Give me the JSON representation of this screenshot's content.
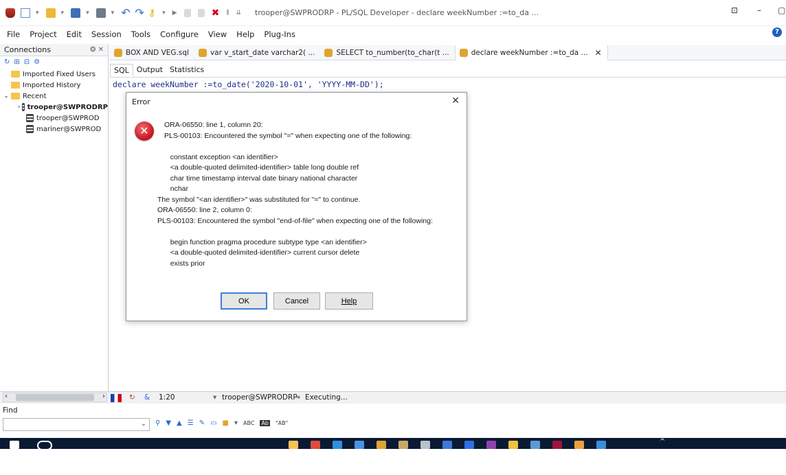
{
  "window": {
    "title": "trooper@SWPRODRP - PL/SQL Developer - declare weekNumber :=to_da ..."
  },
  "menu": [
    "File",
    "Project",
    "Edit",
    "Session",
    "Tools",
    "Configure",
    "View",
    "Help",
    "Plug-Ins"
  ],
  "left_panel": {
    "title": "Connections",
    "pin": "❂ ✕",
    "tree": [
      {
        "label": "Imported Fixed Users",
        "type": "folder"
      },
      {
        "label": "Imported History",
        "type": "folder"
      },
      {
        "label": "Recent",
        "type": "folder",
        "expanded": true
      },
      {
        "label": "trooper@SWPRODRP",
        "type": "db",
        "bold": true
      },
      {
        "label": "trooper@SWPROD",
        "type": "db"
      },
      {
        "label": "mariner@SWPROD",
        "type": "db"
      }
    ]
  },
  "tabs": [
    {
      "label": "BOX AND VEG.sql"
    },
    {
      "label": "var v_start_date varchar2( ..."
    },
    {
      "label": "SELECT to_number(to_char(t ..."
    },
    {
      "label": "declare weekNumber :=to_da ...",
      "active": true
    }
  ],
  "subtabs": [
    "SQL",
    "Output",
    "Statistics"
  ],
  "editor": {
    "code": "declare weekNumber :=to_date('2020-10-01', 'YYYY-MM-DD');"
  },
  "dialog": {
    "title": "Error",
    "close": "✕",
    "icon": "error-icon",
    "lines": [
      "ORA-06550: line 1, column 20:",
      "PLS-00103: Encountered the symbol \"=\" when expecting one of the following:",
      "",
      "   constant exception <an identifier>",
      "   <a double-quoted delimited-identifier> table long double ref",
      "   char time timestamp interval date binary national character",
      "   nchar",
      "The symbol \"<an identifier>\" was substituted for \"=\" to continue.",
      "ORA-06550: line 2, column 0:",
      "PLS-00103: Encountered the symbol \"end-of-file\" when expecting one of the following:",
      "",
      "   begin function pragma procedure subtype type <an identifier>",
      "   <a double-quoted delimited-identifier> current cursor delete",
      "   exists prior"
    ],
    "buttons": {
      "ok": "OK",
      "cancel": "Cancel",
      "help": "Help"
    }
  },
  "status": {
    "position": "1:20",
    "connection": "trooper@SWPRODRP",
    "state": "Executing..."
  },
  "find": {
    "label": "Find",
    "value": ""
  },
  "colors": {
    "accent": "#3c7fd8",
    "error": "#c1121f",
    "code": "#1c2e8c",
    "taskbar": "#0b1a33"
  }
}
